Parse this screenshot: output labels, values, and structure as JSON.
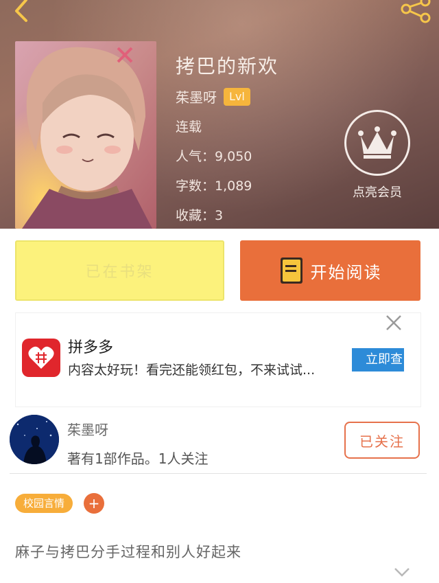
{
  "header": {
    "book_title": "拷巴的新欢",
    "author": "茱墨呀",
    "level_badge": "Lvl",
    "status": "连载",
    "popularity": "人气：9,050",
    "word_count": "字数：1,089",
    "favorites": "收藏：3",
    "vip_label": "点亮会员"
  },
  "icons": {
    "back": "chevron-left-icon",
    "share": "share-icon",
    "crown": "crown-icon",
    "book": "book-icon",
    "close": "close-icon",
    "expand": "chevron-down-icon"
  },
  "actions": {
    "shelf_label": "已在书架",
    "read_label": "开始阅读"
  },
  "ad": {
    "name": "拼多多",
    "description": "内容太好玩！看完还能领红包，不来试试...",
    "cta": "立即查"
  },
  "author_section": {
    "name": "茱墨呀",
    "stats": "著有1部作品。1人关注",
    "follow_label": "已关注"
  },
  "tags": {
    "items": [
      "校园言情"
    ],
    "add_symbol": "+"
  },
  "synopsis": "麻子与拷巴分手过程和别人好起来",
  "colors": {
    "accent_orange": "#e96f3b",
    "shelf_yellow": "#fcf27c",
    "tag_orange": "#f7ad3a",
    "level_badge": "#f6b53c",
    "ad_red": "#e0262c",
    "ad_blue": "#2d8bd8"
  }
}
